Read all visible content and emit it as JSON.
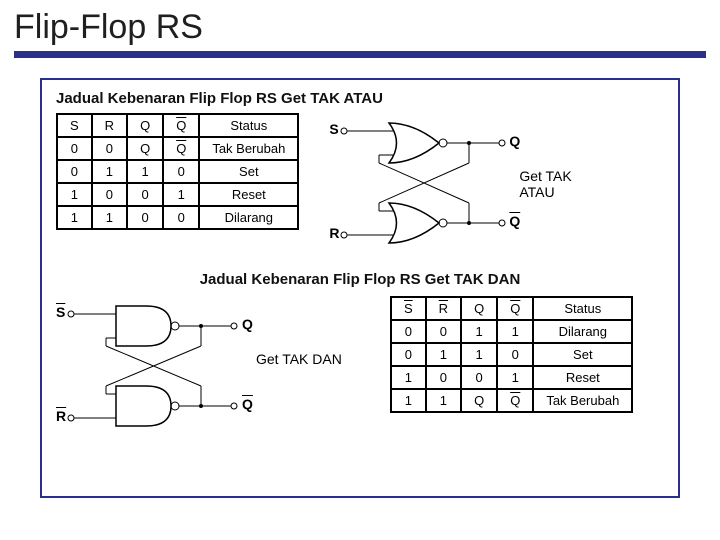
{
  "title": "Flip-Flop RS",
  "section1": {
    "heading": "Jadual Kebenaran Flip Flop RS Get TAK ATAU",
    "headers": {
      "S": "S",
      "R": "R",
      "Q": "Q",
      "Qbar": "Q",
      "Status": "Status"
    },
    "rows": [
      {
        "S": "0",
        "R": "0",
        "Q": "Q",
        "Qbar_over": true,
        "Qbar": "Q",
        "Status": "Tak Berubah"
      },
      {
        "S": "0",
        "R": "1",
        "Q": "1",
        "Qbar_over": false,
        "Qbar": "0",
        "Status": "Set"
      },
      {
        "S": "1",
        "R": "0",
        "Q": "0",
        "Qbar_over": false,
        "Qbar": "1",
        "Status": "Reset"
      },
      {
        "S": "1",
        "R": "1",
        "Q": "0",
        "Qbar_over": false,
        "Qbar": "0",
        "Status": "Dilarang"
      }
    ],
    "diagram": {
      "inTop": "S",
      "inBot": "R",
      "outTop": "Q",
      "outBot": "Q",
      "caption": "Get TAK ATAU"
    }
  },
  "section2": {
    "heading": "Jadual Kebenaran Flip Flop RS Get TAK DAN",
    "headers": {
      "S": "S",
      "R": "R",
      "Q": "Q",
      "Qbar": "Q",
      "Status": "Status"
    },
    "rows": [
      {
        "S": "0",
        "R": "0",
        "Q": "1",
        "Qbar_over": false,
        "Qbar": "1",
        "Status": "Dilarang"
      },
      {
        "S": "0",
        "R": "1",
        "Q": "1",
        "Qbar_over": false,
        "Qbar": "0",
        "Status": "Set"
      },
      {
        "S": "1",
        "R": "0",
        "Q": "0",
        "Qbar_over": false,
        "Qbar": "1",
        "Status": "Reset"
      },
      {
        "S": "1",
        "R": "1",
        "Q": "Q",
        "Qbar_over": true,
        "Qbar": "Q",
        "Status": "Tak Berubah"
      }
    ],
    "diagram": {
      "inTop": "S",
      "inBot": "R",
      "outTop": "Q",
      "outBot": "Q",
      "caption": "Get TAK DAN"
    }
  },
  "chart_data": [
    {
      "type": "table",
      "title": "Jadual Kebenaran Flip Flop RS Get TAK ATAU",
      "columns": [
        "S",
        "R",
        "Q",
        "Q̅",
        "Status"
      ],
      "rows": [
        [
          "0",
          "0",
          "Q",
          "Q̅",
          "Tak Berubah"
        ],
        [
          "0",
          "1",
          "1",
          "0",
          "Set"
        ],
        [
          "1",
          "0",
          "0",
          "1",
          "Reset"
        ],
        [
          "1",
          "1",
          "0",
          "0",
          "Dilarang"
        ]
      ],
      "gate": "NOR"
    },
    {
      "type": "table",
      "title": "Jadual Kebenaran Flip Flop RS Get TAK DAN",
      "columns": [
        "S",
        "R",
        "Q",
        "Q̅",
        "Status"
      ],
      "rows": [
        [
          "0",
          "0",
          "1",
          "1",
          "Dilarang"
        ],
        [
          "0",
          "1",
          "1",
          "0",
          "Set"
        ],
        [
          "1",
          "0",
          "0",
          "1",
          "Reset"
        ],
        [
          "1",
          "1",
          "Q",
          "Q̅",
          "Tak Berubah"
        ]
      ],
      "gate": "NAND"
    }
  ]
}
